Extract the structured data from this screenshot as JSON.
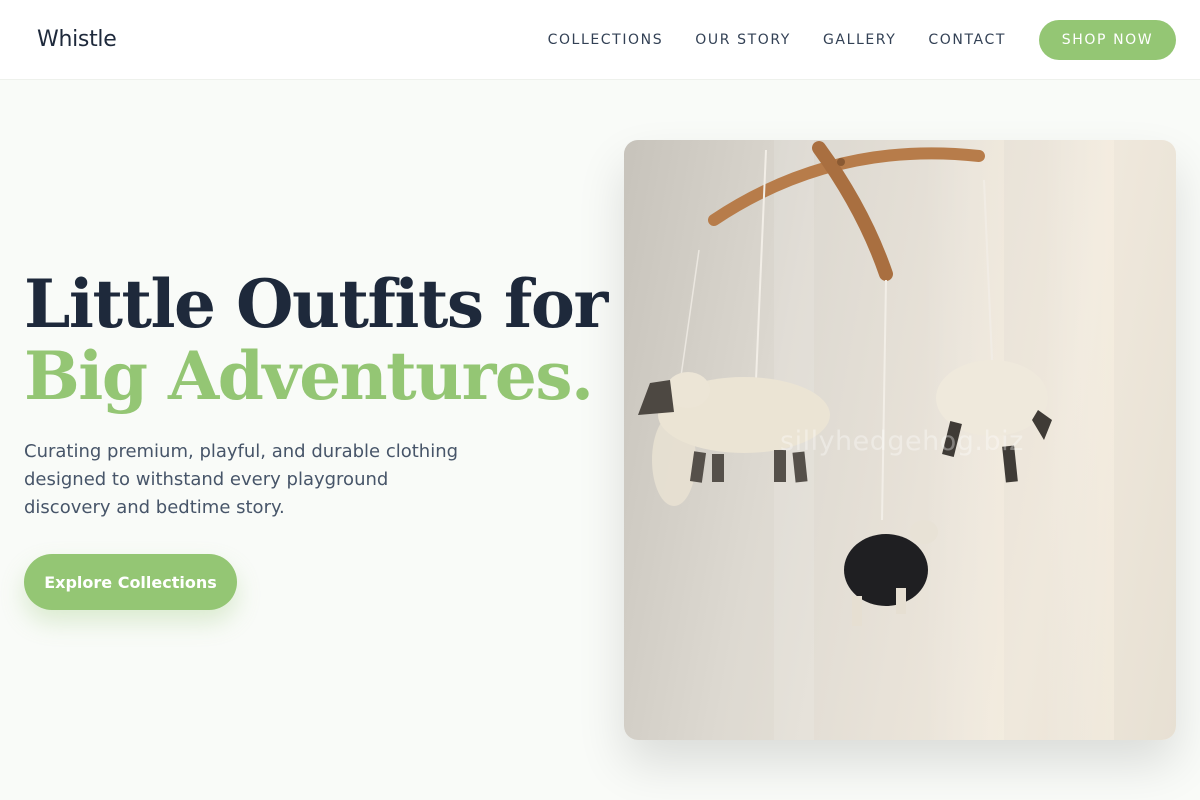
{
  "brand": {
    "name": "Whistle",
    "accent": "#94c674",
    "dark": "#1e293b"
  },
  "nav": {
    "items": [
      {
        "label": "COLLECTIONS"
      },
      {
        "label": "OUR STORY"
      },
      {
        "label": "GALLERY"
      },
      {
        "label": "CONTACT"
      }
    ],
    "cta_label": "SHOP NOW"
  },
  "hero": {
    "title_line1": "Little Outfits for",
    "title_line2": "Big Adventures.",
    "subtitle": "Curating premium, playful, and durable clothing designed to withstand every playground discovery and bedtime story.",
    "cta_label": "Explore Collections",
    "image": {
      "subject": "baby mobile with felt sheep",
      "watermark": "sillyhedgehog.biz"
    }
  }
}
